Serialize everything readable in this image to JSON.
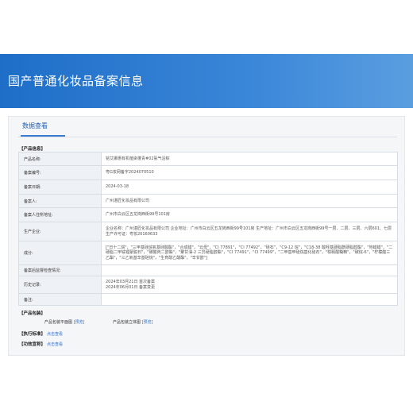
{
  "header": {
    "title": "国产普通化妆品备案信息"
  },
  "tab": {
    "label": "数据查看"
  },
  "sections": {
    "product_info": "【产品信息】",
    "packaging": "【产品包装】",
    "execution": "【执行标准】",
    "efficacy": "【功效宣称】"
  },
  "rows": [
    {
      "label": "产品名称:",
      "value": "铭艾娜惠有机植染蓬青#02氨气沿棕"
    },
    {
      "label": "备案编号:",
      "value": "粤G妆网备字2024070510"
    },
    {
      "label": "备案日期:",
      "value": "2024-03-18"
    },
    {
      "label": "备案人:",
      "value": "广州湛匠化妆品有限公司"
    },
    {
      "label": "备案人住所地址:",
      "value": "广州市白云区五龙岗西街99号101房"
    },
    {
      "label": "生产企业:",
      "value": "企业名称：广州湛匠化妆品有限公司 企业地址：广州市白云区五龙岗西街99号101房 生产地址：广州市白云区五龙岗西街99号一层、二层、三层、六层601、七层 生产许可证：粤妆20160633"
    },
    {
      "label": "成分:",
      "value": "[\"日十二烷\"，\"三甲基硅烷氧基硅酸酯\"，\"合成蜡\"，\"云母\"，\"CI 77891\"，\"CI 77492\"，\"硅石\"，\"C9-12 烷\"，\"C18-38 酸羟基硬脂酰硬脂醇酯\"，\"地蜡蜡\"，\"二硬脂二甲铵锂蒙脱石\"，\"碳酸丙二醇酯\"，\"聚甘油-2 三异硬脂醇酯\"，\"CI 77491\"，\"CI 77499\"，\"二甲基甲硅烷基化硅石\"，\"棕榈酸糊精\"，\"碳烷-6\"，\"柠檬酸三乙酯\"，\"三乙氧基辛基硅烷\"，\"生育酚乙酸酯\"，\"辛甘醇\"]"
    },
    {
      "label": "备案后监督检查情况:",
      "value": ""
    },
    {
      "label": "历史记录:",
      "value": "2024年03月21日 首次备案\n2024年06月01日 备案变更"
    },
    {
      "label": "备注:",
      "value": ""
    }
  ],
  "packaging": {
    "flat_label": "产品包装平面图",
    "flat_link": "[预览]",
    "solid_label": "产品包装立体图",
    "solid_link": "[预览]"
  },
  "links": {
    "execution": "点击查看",
    "efficacy": "点击查看"
  }
}
